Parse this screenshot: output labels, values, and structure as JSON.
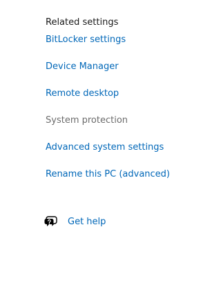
{
  "related_settings": {
    "heading": "Related settings",
    "links": [
      {
        "label": "BitLocker settings",
        "enabled": true
      },
      {
        "label": "Device Manager",
        "enabled": true
      },
      {
        "label": "Remote desktop",
        "enabled": true
      },
      {
        "label": "System protection",
        "enabled": false
      },
      {
        "label": "Advanced system settings",
        "enabled": true
      },
      {
        "label": "Rename this PC (advanced)",
        "enabled": true
      }
    ]
  },
  "help": {
    "icon": "help-chat-icon",
    "label": "Get help"
  },
  "colors": {
    "link": "#0067b8",
    "disabled": "#6b6b6b",
    "heading": "#1a1a1a"
  }
}
